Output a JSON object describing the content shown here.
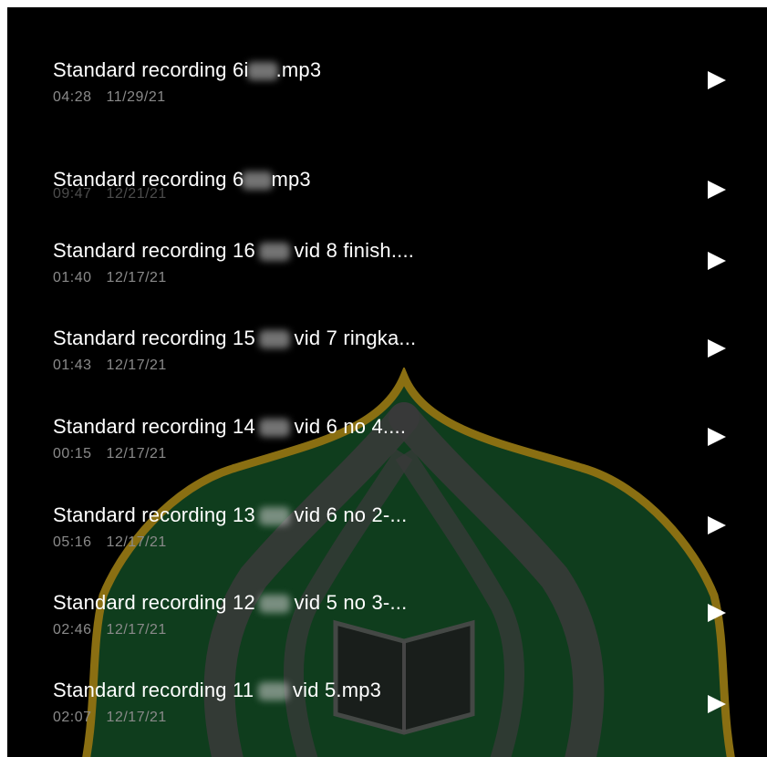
{
  "recordings": [
    {
      "title_start": "Standard recording 6i",
      "title_end": ".mp3",
      "duration": "04:28",
      "date": "11/29/21"
    },
    {
      "title_start": "Standard recording 6",
      "title_end": "mp3",
      "duration": "09:47",
      "date": "12/21/21"
    },
    {
      "title_start": "Standard recording 16",
      "title_end": "vid 8 finish....",
      "duration": "01:40",
      "date": "12/17/21"
    },
    {
      "title_start": "Standard recording 15",
      "title_end": "vid 7 ringka...",
      "duration": "01:43",
      "date": "12/17/21"
    },
    {
      "title_start": "Standard recording 14",
      "title_end": "vid 6 no 4....",
      "duration": "00:15",
      "date": "12/17/21"
    },
    {
      "title_start": "Standard recording 13",
      "title_end": "vid 6 no 2-...",
      "duration": "05:16",
      "date": "12/17/21"
    },
    {
      "title_start": "Standard recording 12",
      "title_end": "vid 5 no 3-...",
      "duration": "02:46",
      "date": "12/17/21"
    },
    {
      "title_start": "Standard recording 11",
      "title_end": "vid 5.mp3",
      "duration": "02:07",
      "date": "12/17/21"
    }
  ],
  "icons": {
    "play": "play-icon",
    "emblem": "university-emblem"
  },
  "colors": {
    "background": "#000000",
    "title_text": "#ffffff",
    "meta_text": "#8a8a8a",
    "emblem_green": "#0f3d1d",
    "emblem_gold": "#8a6f12"
  }
}
